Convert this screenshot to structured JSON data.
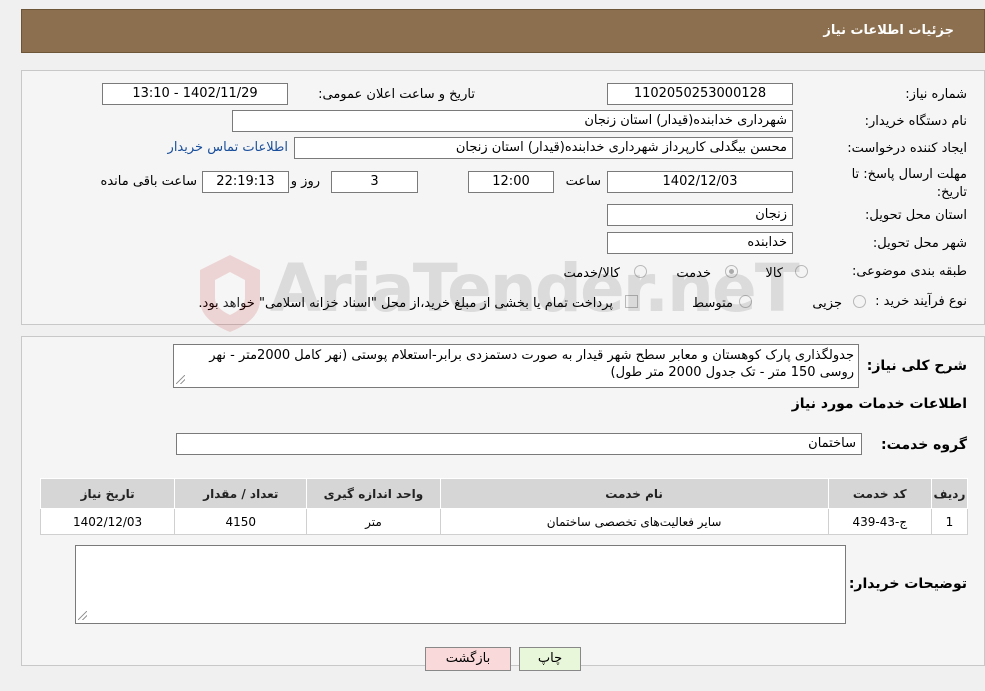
{
  "header": {
    "title": "جزئیات اطلاعات نیاز"
  },
  "form": {
    "need_number_label": "شماره نیاز:",
    "need_number": "1102050253000128",
    "announce_datetime_label": "تاریخ و ساعت اعلان عمومی:",
    "announce_datetime": "1402/11/29 - 13:10",
    "buyer_org_label": "نام دستگاه خریدار:",
    "buyer_org": "شهرداری خدابنده(قیدار) استان زنجان",
    "requester_label": "ایجاد کننده درخواست:",
    "requester": "محسن بیگدلی کارپرداز شهرداری خدابنده(قیدار) استان زنجان",
    "buyer_contact_link": "اطلاعات تماس خریدار",
    "deadline_label_line1": "مهلت ارسال پاسخ: تا",
    "deadline_label_line2": "تاریخ:",
    "deadline_date": "1402/12/03",
    "time_label": "ساعت",
    "deadline_time": "12:00",
    "days_value": "3",
    "days_label": "روز و",
    "remaining_time": "22:19:13",
    "remaining_label": "ساعت باقی مانده",
    "province_label": "استان محل تحویل:",
    "province": "زنجان",
    "city_label": "شهر محل تحویل:",
    "city": "خدابنده",
    "category_label": "طبقه بندی موضوعی:",
    "category_options": [
      {
        "label": "کالا",
        "selected": false
      },
      {
        "label": "خدمت",
        "selected": true
      },
      {
        "label": "کالا/خدمت",
        "selected": false
      }
    ],
    "purchase_type_label": "نوع فرآیند خرید :",
    "purchase_type_options": [
      {
        "label": "جزیی",
        "selected": false
      },
      {
        "label": "متوسط",
        "selected": false
      }
    ],
    "payment_note_checked": false,
    "payment_note": "پرداخت تمام یا بخشی از مبلغ خرید،از محل \"اسناد خزانه اسلامی\" خواهد بود."
  },
  "description": {
    "label": "شرح کلی نیاز:",
    "text": "جدولگذاری پارک کوهستان و معابر سطح شهر قیدار به صورت دستمزدی برابر-استعلام پوستی (نهر کامل 2000متر - نهر روسی 150 متر - تک جدول 2000 متر طول)"
  },
  "services": {
    "section_title": "اطلاعات خدمات مورد نیاز",
    "group_label": "گروه خدمت:",
    "group_value": "ساختمان",
    "columns": [
      "ردیف",
      "کد خدمت",
      "نام خدمت",
      "واحد اندازه گیری",
      "تعداد / مقدار",
      "تاریخ نیاز"
    ],
    "rows": [
      [
        "1",
        "ج-43-439",
        "سایر فعالیت‌های تخصصی ساختمان",
        "متر",
        "4150",
        "1402/12/03"
      ]
    ]
  },
  "buyer_notes": {
    "label": "توضیحات خریدار:",
    "text": ""
  },
  "buttons": {
    "print": "چاپ",
    "back": "بازگشت"
  },
  "watermark": {
    "text": "AriaTender.neT"
  }
}
